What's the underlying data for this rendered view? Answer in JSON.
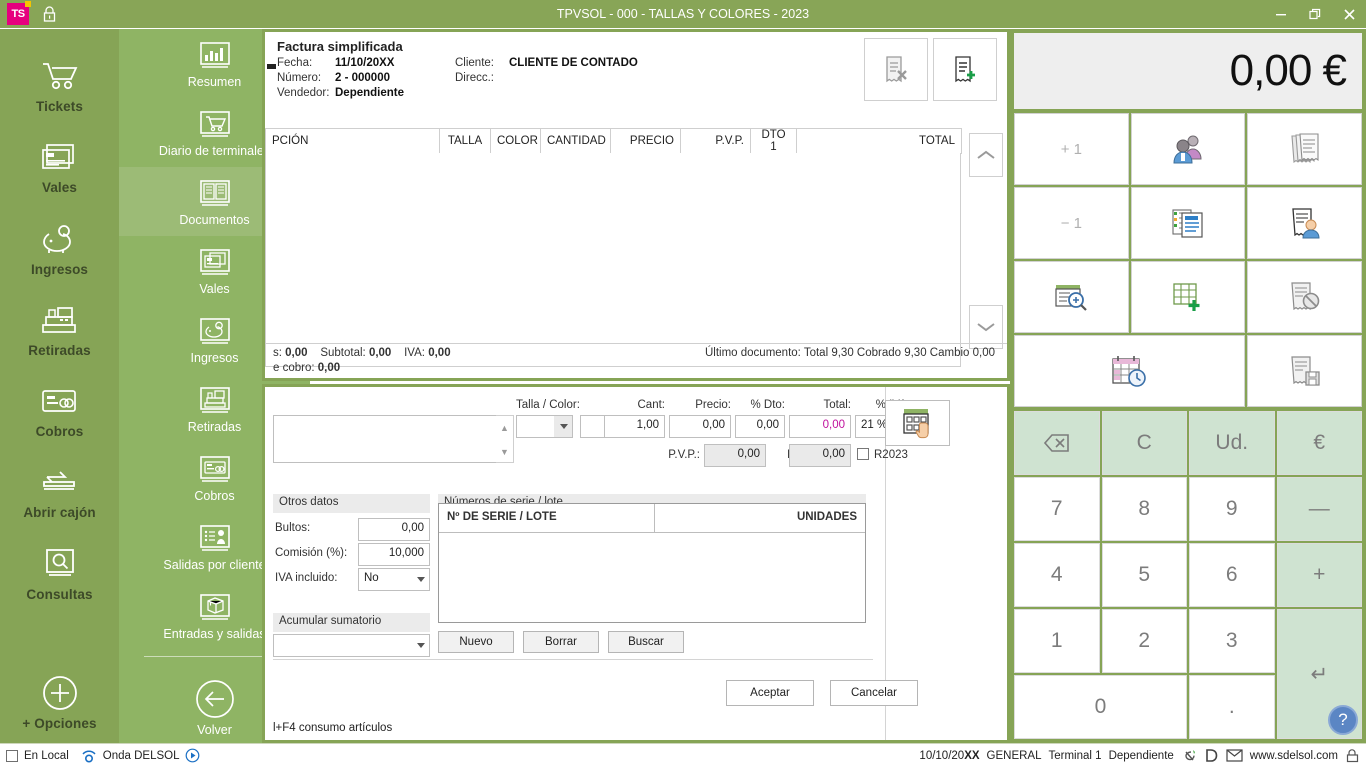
{
  "titlebar": {
    "title": "TPVSOL - 000 - TALLAS Y COLORES - 2023",
    "logo_text": "TS",
    "minimize": "—",
    "maximize": "❐",
    "close": "✕"
  },
  "rail": {
    "items": [
      {
        "label": "Tickets",
        "icon": "cart-icon"
      },
      {
        "label": "Vales",
        "icon": "voucher-icon"
      },
      {
        "label": "Ingresos",
        "icon": "piggybank-icon"
      },
      {
        "label": "Retiradas",
        "icon": "cashregister-icon"
      },
      {
        "label": "Cobros",
        "icon": "card-icon"
      },
      {
        "label": "Abrir cajón",
        "icon": "opendrawer-icon"
      },
      {
        "label": "Consultas",
        "icon": "magnifier-icon"
      },
      {
        "label": "+ Opciones",
        "icon": "plus-circle-icon"
      }
    ]
  },
  "flyout": {
    "items": [
      {
        "label": "Resumen",
        "icon": "barchart-icon",
        "active": false
      },
      {
        "label": "Diario de terminales",
        "icon": "cart-icon",
        "active": false
      },
      {
        "label": "Documentos",
        "icon": "documents-icon",
        "active": true
      },
      {
        "label": "Vales",
        "icon": "voucher-icon",
        "active": false
      },
      {
        "label": "Ingresos",
        "icon": "piggybank-icon",
        "active": false
      },
      {
        "label": "Retiradas",
        "icon": "cashregister-icon",
        "active": false
      },
      {
        "label": "Cobros",
        "icon": "card-icon",
        "active": false
      },
      {
        "label": "Salidas por cliente",
        "icon": "clientlist-icon",
        "active": false
      },
      {
        "label": "Entradas y salidas",
        "icon": "box-icon",
        "active": false
      }
    ],
    "back_label": "Volver",
    "back_icon": "arrow-left-circle-icon"
  },
  "document": {
    "type_label": "Factura simplificada",
    "fields": {
      "fecha_label": "Fecha:",
      "fecha_value": "11/10/20XX",
      "numero_label": "Número:",
      "numero_value": "2 - 000000",
      "vendedor_label": "Vendedor:",
      "vendedor_value": "Dependiente",
      "cliente_label": "Cliente:",
      "cliente_value": "CLIENTE DE CONTADO",
      "direcc_label": "Direcc.:",
      "direcc_value": ""
    },
    "action_buttons": [
      {
        "name": "delete-document-button",
        "icon": "receipt-delete-icon"
      },
      {
        "name": "new-document-button",
        "icon": "receipt-new-icon"
      }
    ],
    "columns": [
      {
        "label": "PCIÓN",
        "align": "left"
      },
      {
        "label": "TALLA",
        "align": "center"
      },
      {
        "label": "COLOR",
        "align": "center"
      },
      {
        "label": "CANTIDAD",
        "align": "center"
      },
      {
        "label": "PRECIO",
        "align": "right"
      },
      {
        "label": "P.V.P.",
        "align": "right"
      },
      {
        "label": "DTO 1",
        "align": "center"
      },
      {
        "label": "TOTAL",
        "align": "right"
      }
    ],
    "rows": [],
    "footer": {
      "l1_a_label": "s:",
      "l1_a_value": "0,00",
      "subtotal_label": "Subtotal:",
      "subtotal_value": "0,00",
      "iva_label": "IVA:",
      "iva_value": "0,00",
      "l2_label": "e cobro:",
      "l2_value": "0,00",
      "last_doc": "Último documento: Total 9,30 Cobrado 9,30 Cambio 0,00"
    },
    "scroll_up": "scroll-up-icon",
    "scroll_down": "scroll-down-icon"
  },
  "form": {
    "talla_color_label": "Talla / Color:",
    "talla_value": "",
    "color_value": "",
    "cant_label": "Cant:",
    "cant_value": "1,00",
    "precio_label": "Precio:",
    "precio_value": "0,00",
    "dto_label": "% Dto:",
    "dto_value": "0,00",
    "total_label": "Total:",
    "total_value": "0,00",
    "iva_label": "% IVA:",
    "iva_value": "21 %",
    "pvp_label": "P.V.P.:",
    "pvp_value": "0,00",
    "ii_label": "I.I.:",
    "ii_value": "0,00",
    "r2023_label": "R2023",
    "otros_datos_label": "Otros datos",
    "bultos_label": "Bultos:",
    "bultos_value": "0,00",
    "comision_label": "Comisión (%):",
    "comision_value": "10,000",
    "iva_incluido_label": "IVA incluido:",
    "iva_incluido_value": "No",
    "acumular_label": "Acumular sumatorio",
    "acumular_value": "",
    "serie_section_label": "Números de serie / lote",
    "serie_col1": "Nº DE SERIE / LOTE",
    "serie_col2": "UNIDADES",
    "serie_rows": [],
    "nuevo_label": "Nuevo",
    "borrar_label": "Borrar",
    "buscar_label": "Buscar",
    "aceptar_label": "Aceptar",
    "cancelar_label": "Cancelar",
    "hint": "l+F4 consumo artículos",
    "grid_button_icon": "grid-touch-icon"
  },
  "right_panel": {
    "amount": "0,00 €",
    "function_buttons": [
      {
        "label": "+ 1",
        "icon": "",
        "name": "plus-one-button"
      },
      {
        "label": "",
        "icon": "customers-icon",
        "name": "customers-button"
      },
      {
        "label": "",
        "icon": "receipts-stack-icon",
        "name": "receipts-stack-button"
      },
      {
        "label": "− 1",
        "icon": "",
        "name": "minus-one-button"
      },
      {
        "label": "",
        "icon": "documents-stack-icon",
        "name": "documents-stack-button"
      },
      {
        "label": "",
        "icon": "receipt-person-icon",
        "name": "receipt-person-button"
      },
      {
        "label": "",
        "icon": "document-search-icon",
        "name": "document-search-button"
      },
      {
        "label": "",
        "icon": "table-add-icon",
        "name": "table-add-button"
      },
      {
        "label": "",
        "icon": "receipt-cancel-icon",
        "name": "receipt-cancel-button"
      },
      {
        "label": "",
        "icon": "calendar-clock-icon",
        "name": "calendar-clock-button"
      },
      {
        "label": "",
        "icon": "receipt-save-icon",
        "name": "receipt-save-button"
      }
    ],
    "keypad": [
      {
        "label": "⌫",
        "style": "green",
        "name": "key-backspace"
      },
      {
        "label": "C",
        "style": "green",
        "name": "key-clear"
      },
      {
        "label": "Ud.",
        "style": "green",
        "name": "key-units"
      },
      {
        "label": "€",
        "style": "green",
        "name": "key-euro"
      },
      {
        "label": "7",
        "style": "",
        "name": "key-7"
      },
      {
        "label": "8",
        "style": "",
        "name": "key-8"
      },
      {
        "label": "9",
        "style": "",
        "name": "key-9"
      },
      {
        "label": "—",
        "style": "green",
        "name": "key-minus"
      },
      {
        "label": "4",
        "style": "",
        "name": "key-4"
      },
      {
        "label": "5",
        "style": "",
        "name": "key-5"
      },
      {
        "label": "6",
        "style": "",
        "name": "key-6"
      },
      {
        "label": "+",
        "style": "green",
        "name": "key-plus"
      },
      {
        "label": "1",
        "style": "",
        "name": "key-1"
      },
      {
        "label": "2",
        "style": "",
        "name": "key-2"
      },
      {
        "label": "3",
        "style": "",
        "name": "key-3"
      },
      {
        "label": "↵",
        "style": "green",
        "name": "key-enter"
      },
      {
        "label": "0",
        "style": "",
        "name": "key-0"
      },
      {
        "label": ".",
        "style": "",
        "name": "key-decimal"
      }
    ],
    "help_label": "?"
  },
  "statusbar": {
    "en_local": "En Local",
    "onda_delsol": "Onda DELSOL",
    "date": "10/10/20",
    "date_bold": "XX",
    "general": "GENERAL",
    "terminal": "Terminal 1",
    "user": "Dependiente",
    "website": "www.sdelsol.com"
  }
}
